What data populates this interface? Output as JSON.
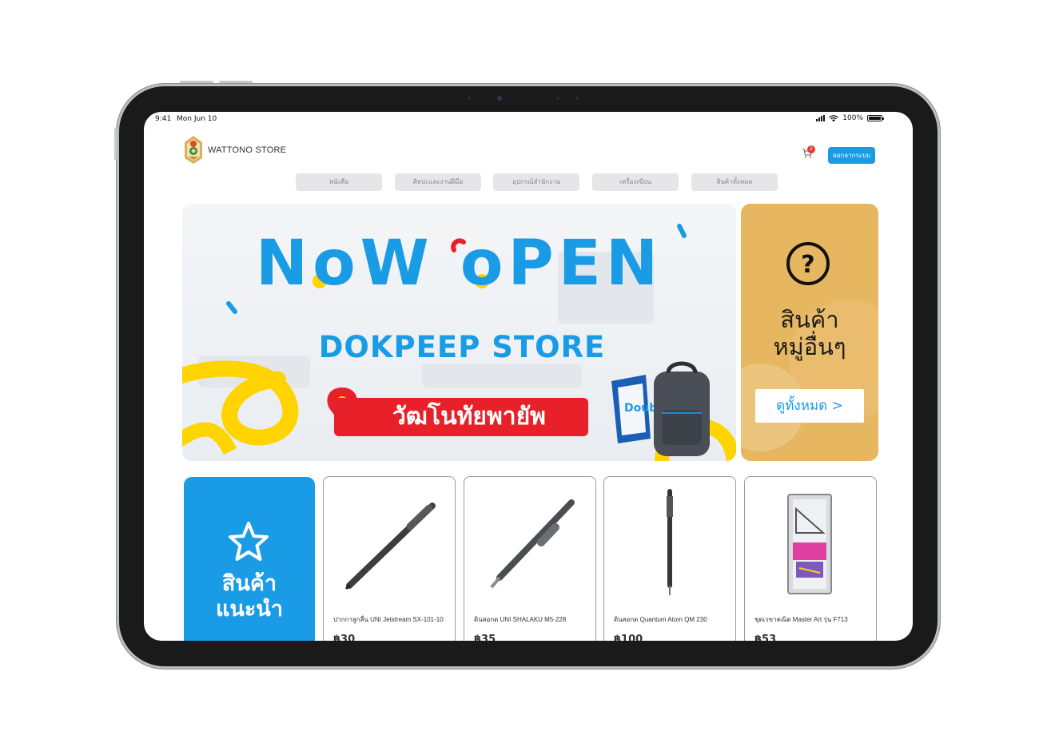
{
  "status_bar": {
    "time": "9:41",
    "date": "Mon Jun 10",
    "battery": "100%",
    "battery_level": 1.0
  },
  "header": {
    "brand": "WATTONO STORE",
    "cart_count": "2",
    "logout_label": "ออกจากระบบ"
  },
  "nav": {
    "items": [
      {
        "label": "หนังสือ"
      },
      {
        "label": "ศิลปะและงานฝีมือ"
      },
      {
        "label": "อุปกรณ์สำนักงาน"
      },
      {
        "label": "เครื่องเขียน"
      },
      {
        "label": "สินค้าทั้งหมด"
      }
    ]
  },
  "banner": {
    "title": "NoW oPEN",
    "subtitle": "DOKPEEP STORE",
    "place": "วัฒโนทัยพายัพ",
    "paper_brand": "Double A"
  },
  "other_categories": {
    "label_line1": "สินค้า",
    "label_line2": "หมู่อื่นๆ",
    "see_all": "ดูทั้งหมด >"
  },
  "recommended": {
    "label_line1": "สินค้า",
    "label_line2": "แนะนำ"
  },
  "products": [
    {
      "name": "ปากกาลูกลื่น UNI Jetstream SX-101-10",
      "price": "฿30"
    },
    {
      "name": "ดินสอกด UNI SHALAKU M5-228",
      "price": "฿35"
    },
    {
      "name": "ดินสอกด Quantum Atom QM 230",
      "price": "฿100"
    },
    {
      "name": "ชุดเรขาคณิต Master Art รุ่น F713",
      "price": "฿53"
    }
  ],
  "colors": {
    "accent": "#1a9be6",
    "gold": "#e6b661",
    "badge": "#e53935",
    "banner_red": "#e8202a",
    "banner_yellow": "#ffd400"
  },
  "icons": [
    "logo-emblem",
    "cart-icon",
    "question-circle-icon",
    "star-icon",
    "signal-icon",
    "wifi-icon",
    "battery-icon",
    "location-pin-icon"
  ]
}
